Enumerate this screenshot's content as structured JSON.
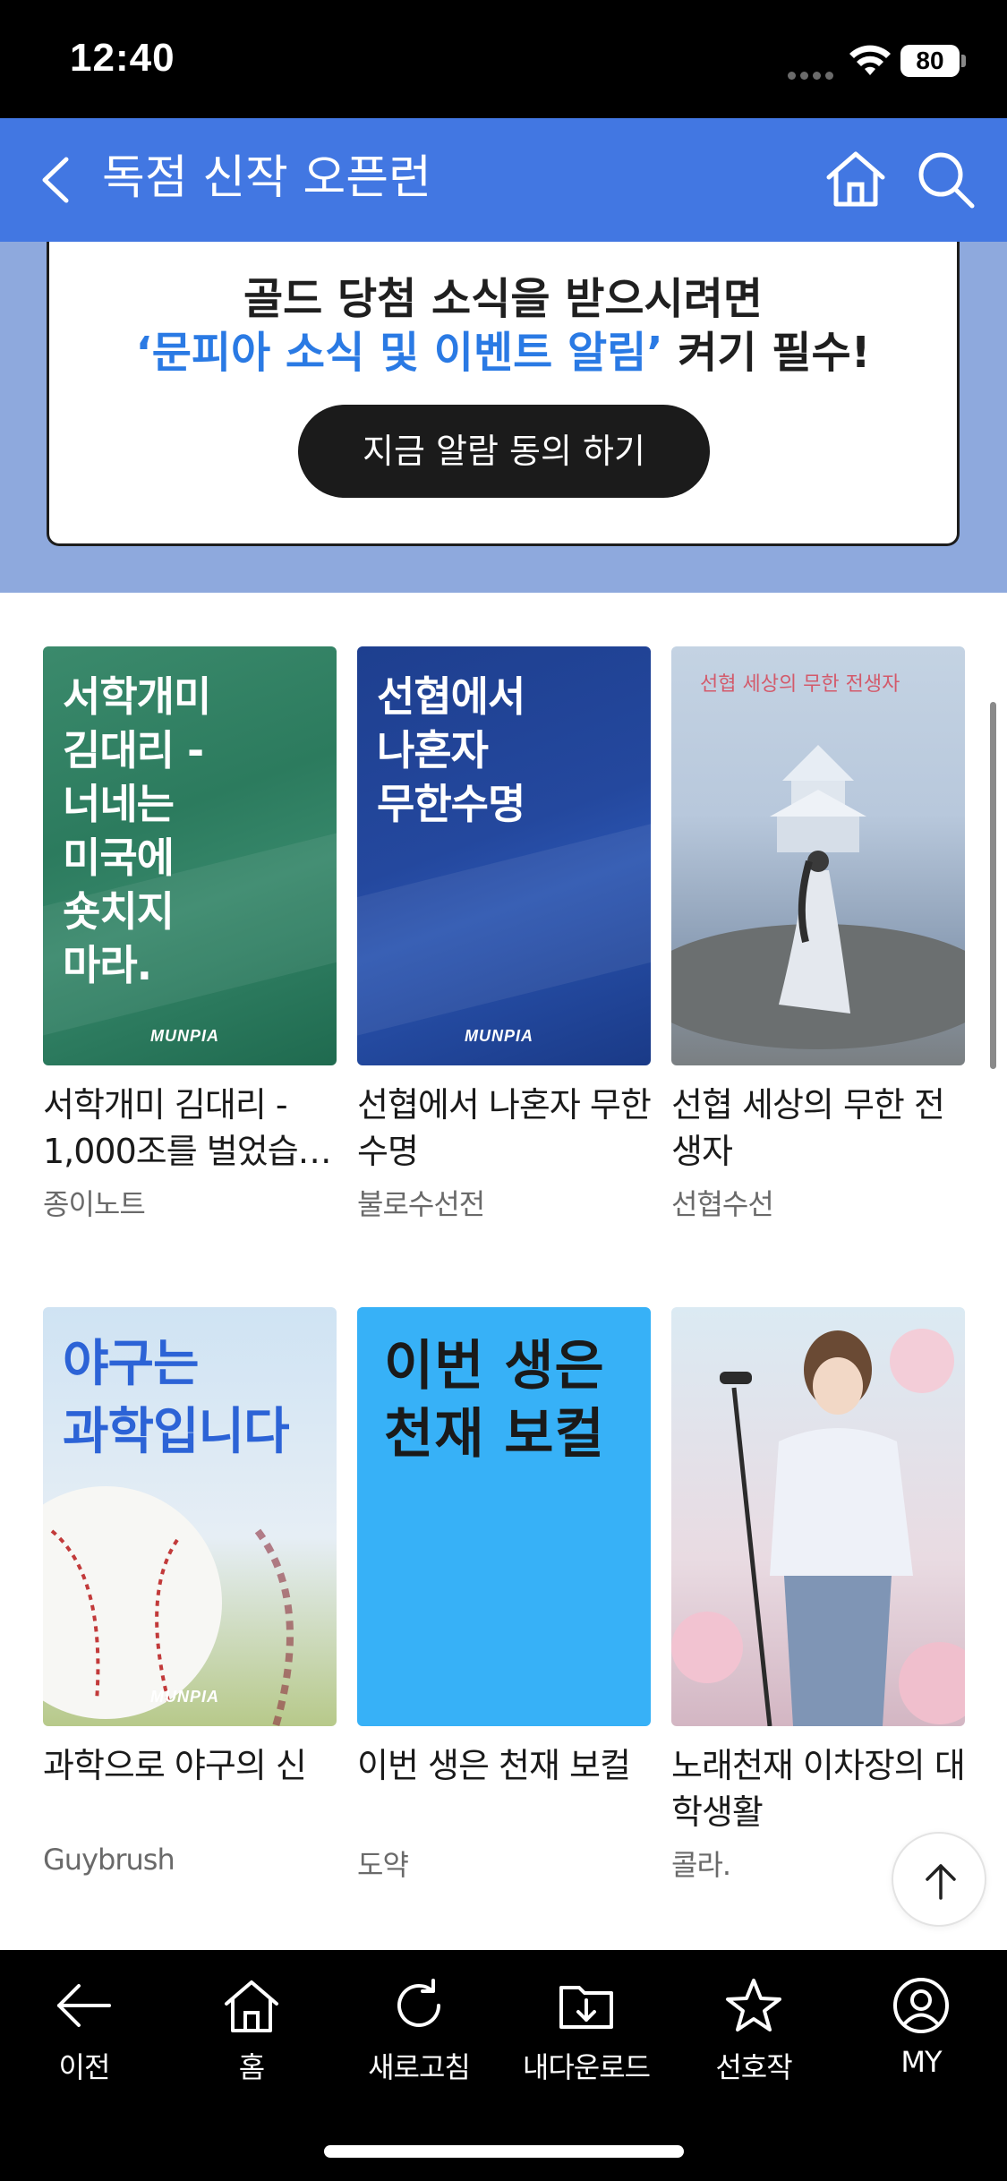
{
  "status_bar": {
    "time": "12:40",
    "battery": "80"
  },
  "header": {
    "title": "독점 신작 오픈런"
  },
  "banner": {
    "line1": "골드 당첨 소식을 받으시려면",
    "line2_highlight": "‘문피아 소식 및 이벤트 알림’",
    "line2_rest": " 켜기 필수!",
    "button_label": "지금 알람 동의 하기"
  },
  "books": [
    {
      "title": "서학개미 김대리 - 1,000조를 벌었습…",
      "author": "종이노트",
      "cover_text": "서학개미\n김대리 -\n너네는\n미국에\n숏치지\n마라.",
      "cover_logo": "MUNPIA"
    },
    {
      "title": "선협에서 나혼자 무한수명",
      "author": "불로수선전",
      "cover_text": "선협에서\n나혼자\n무한수명",
      "cover_logo": "MUNPIA"
    },
    {
      "title": "선협 세상의 무한 전생자",
      "author": "선협수선",
      "cover_text": "선협 세상의 무한 전생자"
    },
    {
      "title": "과학으로 야구의 신",
      "author": "Guybrush",
      "cover_text": "야구는\n과학입니다",
      "cover_logo": "MUNPIA"
    },
    {
      "title": "이번 생은 천재 보컬",
      "author": "도약",
      "cover_text": "이번 생은\n천재 보컬"
    },
    {
      "title": "노래천재 이차장의 대학생활",
      "author": "콜라."
    }
  ],
  "bottom_nav": {
    "back": "이전",
    "home": "홈",
    "refresh": "새로고침",
    "downloads": "내다운로드",
    "favorites": "선호작",
    "my": "MY"
  }
}
